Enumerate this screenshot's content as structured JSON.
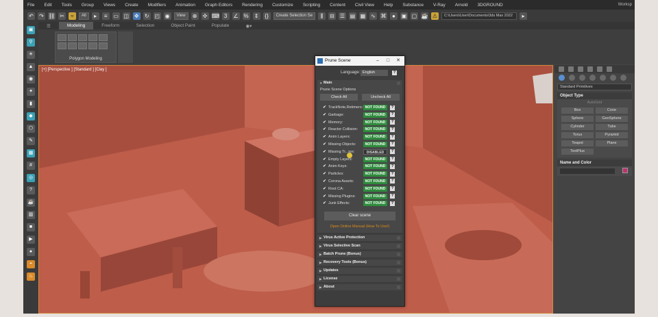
{
  "menubar": {
    "items": [
      "File",
      "Edit",
      "Tools",
      "Group",
      "Views",
      "Create",
      "Modifiers",
      "Animation",
      "Graph Editors",
      "Rendering",
      "Customize",
      "Scripting",
      "Content",
      "Civil View",
      "Help",
      "Substance",
      "V-Ray",
      "Arnold",
      "3DGROUND"
    ],
    "workspace": "Worksp"
  },
  "toolbar": {
    "selection_filter": "All",
    "view_dropdown": "View",
    "selection_set": "Create Selection Se",
    "path": "C:\\Users\\User\\Documents\\3ds Max 2022"
  },
  "ribbon": {
    "tabs": [
      "Modeling",
      "Freeform",
      "Selection",
      "Object Paint",
      "Populate"
    ],
    "active_tab": "Modeling",
    "panel_label": "Polygon Modeling"
  },
  "viewport": {
    "label": "[+] [Perspective ] [Standard ] [Clay ]"
  },
  "command_panel": {
    "dropdown": "Standard Primitives",
    "object_type": {
      "title": "Object Type",
      "autogrid": "AutoGrid",
      "buttons": [
        "Box",
        "Cone",
        "Sphere",
        "GeoSphere",
        "Cylinder",
        "Tube",
        "Torus",
        "Pyramid",
        "Teapot",
        "Plane",
        "TextPlus"
      ]
    },
    "name_color": {
      "title": "Name and Color",
      "swatch_color": "#c2306e"
    }
  },
  "dialog": {
    "title": "Prune Scene",
    "language_label": "Language:",
    "language_value": "English",
    "main_section": "Main",
    "options_label": "Prune Scene Options",
    "check_all": "Check All",
    "uncheck_all": "Uncheck All",
    "items": [
      {
        "label": "TrackNote,Retimers:",
        "status": "NOT FOUND",
        "type": "nf"
      },
      {
        "label": "Garbage:",
        "status": "NOT FOUND",
        "type": "nf"
      },
      {
        "label": "Memory:",
        "status": "NOT FOUND",
        "type": "nf"
      },
      {
        "label": "Reactor Collision:",
        "status": "NOT FOUND",
        "type": "nf"
      },
      {
        "label": "Anim Layers:",
        "status": "NOT FOUND",
        "type": "nf"
      },
      {
        "label": "Missing Objects:",
        "status": "NOT FOUND",
        "type": "nf"
      },
      {
        "label": "Missing Tr...ion:",
        "status": "DISABLED",
        "type": "dis"
      },
      {
        "label": "Empty Layers:",
        "status": "NOT FOUND",
        "type": "nf"
      },
      {
        "label": "Anim Keys:",
        "status": "NOT FOUND",
        "type": "nf"
      },
      {
        "label": "Particles:",
        "status": "NOT FOUND",
        "type": "nf"
      },
      {
        "label": "Corona Assets:",
        "status": "NOT FOUND",
        "type": "nf"
      },
      {
        "label": "Root CA:",
        "status": "NOT FOUND",
        "type": "nf"
      },
      {
        "label": "Missing Plugins:",
        "status": "NOT FOUND",
        "type": "nf"
      },
      {
        "label": "Junk Effects:",
        "status": "NOT FOUND",
        "type": "nf"
      }
    ],
    "clear_scene": "Clear scene",
    "manual_link": "Open Online Manual (How To Use!)",
    "sections": [
      "Virus Active Protection",
      "Virus Selective Scan",
      "Batch Prune (Bonus)",
      "Recovery Tools (Bonus)",
      "Updates",
      "License",
      "About"
    ]
  },
  "colors": {
    "viewport": "#b95a48",
    "not_found": "#2e8b3c",
    "accent_orange": "#e08a1a"
  }
}
